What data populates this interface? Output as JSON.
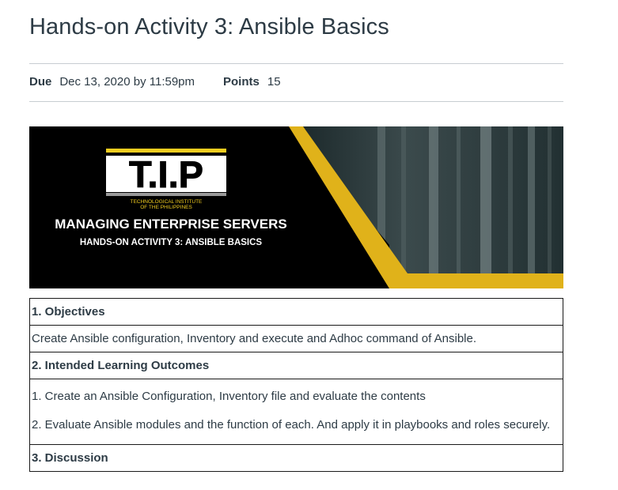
{
  "assignment": {
    "title": "Hands-on Activity 3: Ansible Basics",
    "due_label": "Due",
    "due_value": "Dec 13, 2020 by 11:59pm",
    "points_label": "Points",
    "points_value": "15"
  },
  "banner": {
    "logo_text": "T.I.P",
    "institute_line1": "TECHNOLOGICAL INSTITUTE",
    "institute_line2": "OF THE PHILIPPINES",
    "course_title": "MANAGING ENTERPRISE SERVERS",
    "activity_title": "HANDS-ON ACTIVITY 3: ANSIBLE BASICS",
    "colors": {
      "accent": "#e8b800",
      "dark": "#000000"
    }
  },
  "table": {
    "objectives_heading": "1. Objectives",
    "objectives_text": "Create Ansible configuration, Inventory and execute and Adhoc command of Ansible.",
    "outcomes_heading": "2. Intended Learning Outcomes",
    "outcomes": [
      "1. Create an Ansible Configuration, Inventory file and evaluate the contents",
      "2. Evaluate Ansible modules and the function of each. And apply it in playbooks and roles securely."
    ],
    "discussion_heading": "3. Discussion"
  }
}
